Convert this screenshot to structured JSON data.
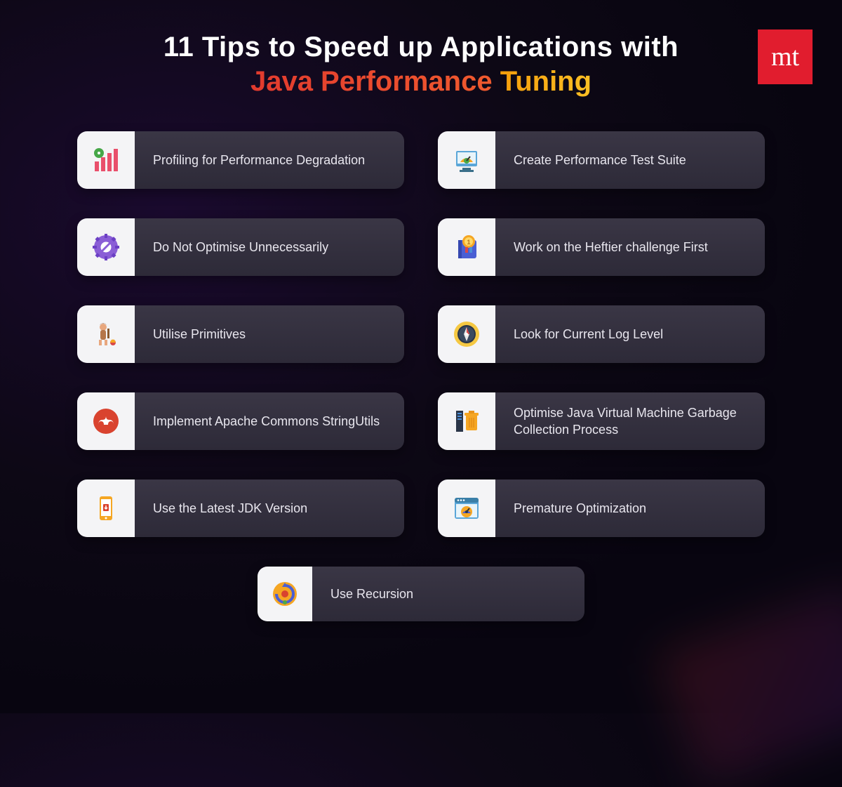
{
  "logo_text": "mt",
  "title": {
    "line1": "11 Tips to Speed up Applications with",
    "line2_part1": "Java Performance",
    "line2_part2": "Tuning"
  },
  "cards": [
    {
      "label": "Profiling for Performance Degradation",
      "icon": "chart-bar-gear-icon"
    },
    {
      "label": "Create Performance Test Suite",
      "icon": "monitor-gauge-icon"
    },
    {
      "label": "Do Not Optimise Unnecessarily",
      "icon": "gear-forbid-icon"
    },
    {
      "label": "Work on the Heftier challenge First",
      "icon": "medal-book-icon"
    },
    {
      "label": "Utilise Primitives",
      "icon": "caveman-icon"
    },
    {
      "label": "Look for Current Log Level",
      "icon": "compass-circle-icon"
    },
    {
      "label": "Implement Apache Commons StringUtils",
      "icon": "stumble-icon"
    },
    {
      "label": "Optimise Java Virtual Machine Garbage Collection Process",
      "icon": "trash-server-icon"
    },
    {
      "label": "Use the Latest JDK Version",
      "icon": "phone-download-icon"
    },
    {
      "label": "Premature Optimization",
      "icon": "browser-gauge-icon"
    },
    {
      "label": "Use Recursion",
      "icon": "loop-circle-icon"
    }
  ]
}
